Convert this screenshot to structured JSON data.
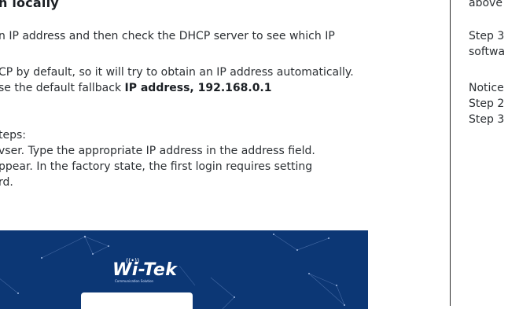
{
  "doc": {
    "heading": "h locally",
    "p1_l1": "n IP address and then check the DHCP server to see which IP",
    "p2_l1": "CP by default, so it will try to obtain an IP address automatically.",
    "p2_l2_a": "se the default fallback ",
    "p2_l2_b": "IP address, 192.168.0.1",
    "p3_l1": "teps:",
    "p3_l2": "vser. Type the appropriate IP address in the address field.",
    "p3_l3": "ppear. In the factory state, the first login requires setting",
    "p3_l4": "rd."
  },
  "screenshot": {
    "logo_text": "Wi-Tek",
    "logo_wave": "((•))",
    "logo_subtitle": "Communication Solution",
    "background_color": "#0c3775"
  },
  "sidebar": {
    "lines": [
      "above",
      "Step 3",
      "softwa",
      "Notice",
      "Step 2",
      "Step 3"
    ]
  }
}
